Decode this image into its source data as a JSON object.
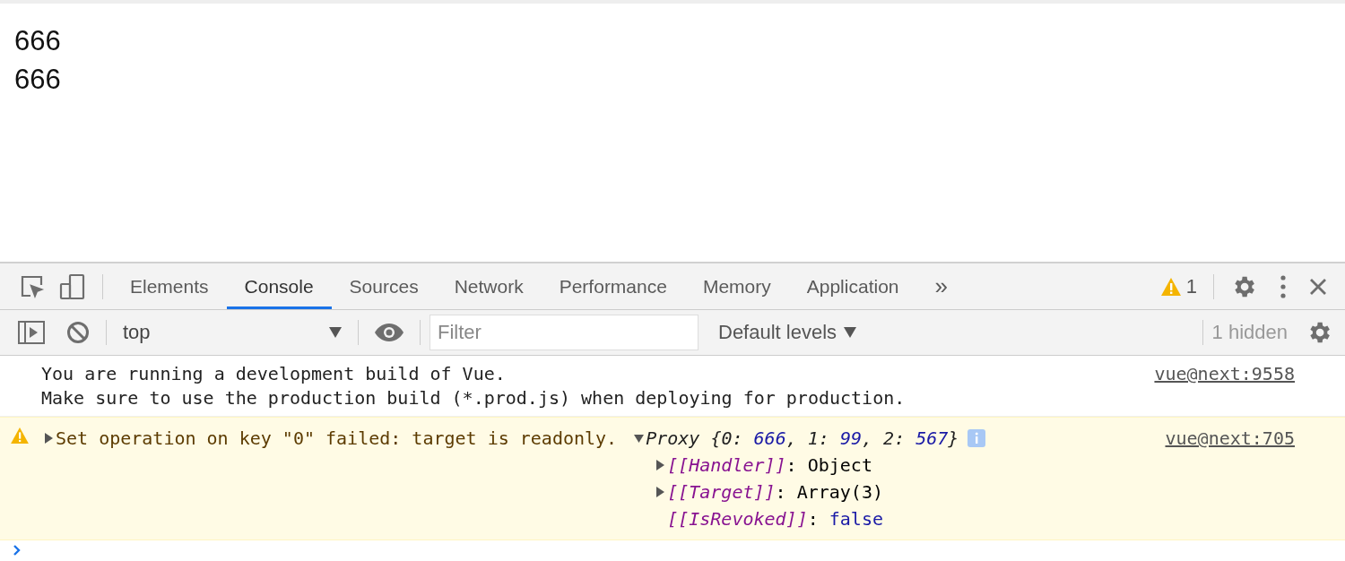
{
  "page": {
    "lines": [
      "666",
      "666"
    ]
  },
  "devtools": {
    "tabs": [
      {
        "label": "Elements",
        "selected": false
      },
      {
        "label": "Console",
        "selected": true
      },
      {
        "label": "Sources",
        "selected": false
      },
      {
        "label": "Network",
        "selected": false
      },
      {
        "label": "Performance",
        "selected": false
      },
      {
        "label": "Memory",
        "selected": false
      },
      {
        "label": "Application",
        "selected": false
      }
    ],
    "overflow": "»",
    "warning_count": "1"
  },
  "console_toolbar": {
    "context": "top",
    "filter_placeholder": "Filter",
    "levels": "Default levels",
    "hidden": "1 hidden"
  },
  "messages": [
    {
      "kind": "info",
      "lines": [
        "You are running a development build of Vue.",
        "Make sure to use the production build (*.prod.js) when deploying for production."
      ],
      "source": "vue@next:9558"
    },
    {
      "kind": "warning",
      "expanded": false,
      "text": "Set operation on key \"0\" failed: target is readonly.",
      "source": "vue@next:705",
      "object": {
        "prefix": "Proxy",
        "expanded": true,
        "segments": [
          {
            "kind": "plain",
            "text": "{0: "
          },
          {
            "kind": "number",
            "text": "666"
          },
          {
            "kind": "plain",
            "text": ", 1: "
          },
          {
            "kind": "number",
            "text": "99"
          },
          {
            "kind": "plain",
            "text": ", 2: "
          },
          {
            "kind": "number",
            "text": "567"
          },
          {
            "kind": "plain",
            "text": "}"
          }
        ],
        "properties": [
          {
            "kind": "object",
            "expanded": false,
            "segments": [
              {
                "kind": "name",
                "text": "[[Handler]]"
              },
              {
                "kind": "plain",
                "text": ": Object"
              }
            ]
          },
          {
            "kind": "object",
            "expanded": false,
            "segments": [
              {
                "kind": "name",
                "text": "[[Target]]"
              },
              {
                "kind": "plain",
                "text": ": Array(3)"
              }
            ]
          },
          {
            "kind": "boolean",
            "segments": [
              {
                "kind": "name",
                "text": "[[IsRevoked]]"
              },
              {
                "kind": "plain",
                "text": ": "
              },
              {
                "kind": "number",
                "text": "false"
              }
            ]
          }
        ]
      }
    }
  ]
}
